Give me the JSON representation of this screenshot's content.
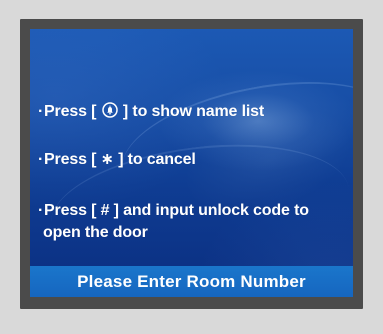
{
  "instructions": {
    "bullet_symbol": "·",
    "show_list": {
      "prefix": "Press [",
      "key_icon": "bell-icon",
      "suffix": "] to show name list"
    },
    "cancel": {
      "prefix": "Press [",
      "key_label": "∗",
      "suffix": "] to cancel"
    },
    "unlock": {
      "prefix": "Press [",
      "key_label": "#",
      "suffix": "] and input unlock code to",
      "continuation": "open the door"
    }
  },
  "status_bar": {
    "label": "Please Enter Room Number"
  },
  "colors": {
    "frame": "#4b4b4b",
    "screen_top": "#1c59b4",
    "screen_bottom": "#0b2e80",
    "footer": "#1769c2",
    "text": "#ffffff"
  }
}
